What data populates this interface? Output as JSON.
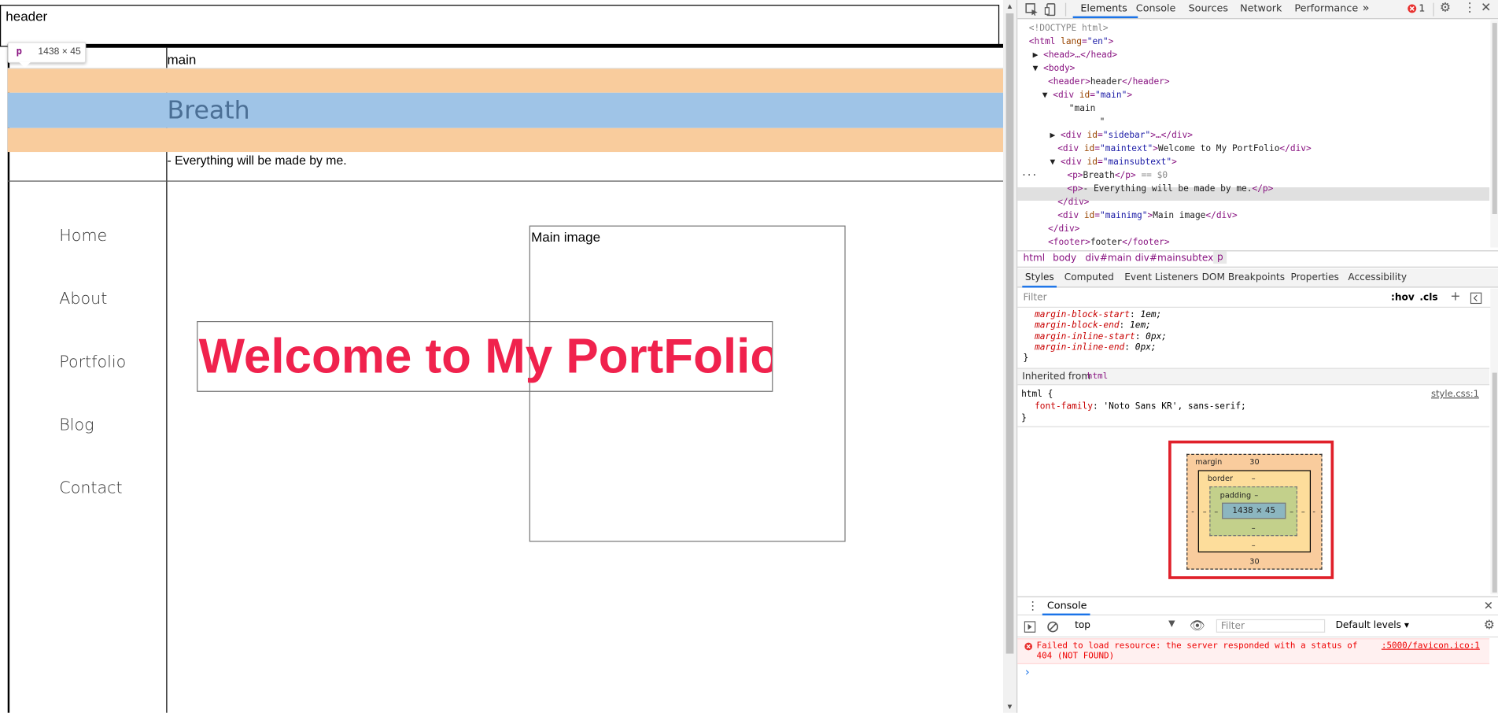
{
  "page": {
    "header_text": "header",
    "main_label": "main",
    "breath_text": "Breath",
    "subline_text": "- Everything will be made by me.",
    "nav_items": [
      "Home",
      "About",
      "Portfolio",
      "Blog",
      "Contact"
    ],
    "main_image_label": "Main image",
    "welcome_text": "Welcome to My PortFolio",
    "tooltip": {
      "tag": "p",
      "dimensions": "1438 × 45"
    }
  },
  "devtools": {
    "tabs": [
      "Elements",
      "Console",
      "Sources",
      "Network",
      "Performance"
    ],
    "more_tabs_icon": "»",
    "error_count": "1",
    "dom_lines": {
      "l1": "<!DOCTYPE html>",
      "l2_tag": "<html ",
      "l2_attr": "lang",
      "l2_val": "\"en\"",
      "l2_end": ">",
      "l3": "<head>…</head>",
      "l4": "<body>",
      "l5_tag1": "<header>",
      "l5_text": "header",
      "l5_tag2": "</header>",
      "l6_tag": "<div ",
      "l6_attr": "id",
      "l6_val": "\"main\"",
      "l6_end": ">",
      "l7_text": "\"main",
      "l8_text": "\"",
      "l9_tag": "<div ",
      "l9_attr": "id",
      "l9_val": "\"sidebar\"",
      "l9_end": ">…</div>",
      "l10_tag": "<div ",
      "l10_attr": "id",
      "l10_val": "\"maintext\"",
      "l10_gt": ">",
      "l10_text": "Welcome to My PortFolio",
      "l10_end": "</div>",
      "l11_tag": "<div ",
      "l11_attr": "id",
      "l11_val": "\"mainsubtext\"",
      "l11_end": ">",
      "l12_tag1": "<p>",
      "l12_text": "Breath",
      "l12_tag2": "</p>",
      "l12_eq": " == $0",
      "l13_tag1": "<p>",
      "l13_text": "- Everything will be made by me.",
      "l13_tag2": "</p>",
      "l14": "</div>",
      "l15_tag": "<div ",
      "l15_attr": "id",
      "l15_val": "\"mainimg\"",
      "l15_gt": ">",
      "l15_text": "Main image",
      "l15_end": "</div>",
      "l16": "</div>",
      "l17_tag1": "<footer>",
      "l17_text": "footer",
      "l17_tag2": "</footer>"
    },
    "breadcrumbs": [
      "html",
      "body",
      "div#main",
      "div#mainsubtext",
      "p"
    ],
    "styles_tabs": [
      "Styles",
      "Computed",
      "Event Listeners",
      "DOM Breakpoints",
      "Properties",
      "Accessibility"
    ],
    "filter_placeholder": "Filter",
    "hov_label": ":hov",
    "cls_label": ".cls",
    "ua_rules": [
      {
        "prop": "margin-block-start",
        "val": "1em;"
      },
      {
        "prop": "margin-block-end",
        "val": "1em;"
      },
      {
        "prop": "margin-inline-start",
        "val": "0px;"
      },
      {
        "prop": "margin-inline-end",
        "val": "0px;"
      }
    ],
    "close_brace": "}",
    "inherited_label": "Inherited from",
    "inherited_from": "html",
    "html_selector": "html {",
    "html_rule_prop": "font-family",
    "html_rule_val": "'Noto Sans KR', sans-serif;",
    "style_source": "style.css:1",
    "box_model": {
      "margin_label": "margin",
      "margin_top": "30",
      "margin_bottom": "30",
      "margin_side": "-",
      "border_label": "border",
      "border_val": "–",
      "padding_label": "padding",
      "padding_val": "–",
      "content": "1438 × 45"
    },
    "console": {
      "title": "Console",
      "context": "top",
      "filter_placeholder": "Filter",
      "levels": "Default levels ▾",
      "error_message": "Failed to load resource: the server responded with a status of 404 (NOT FOUND)",
      "error_source": ":5000/favicon.ico:1",
      "prompt": "›"
    }
  }
}
